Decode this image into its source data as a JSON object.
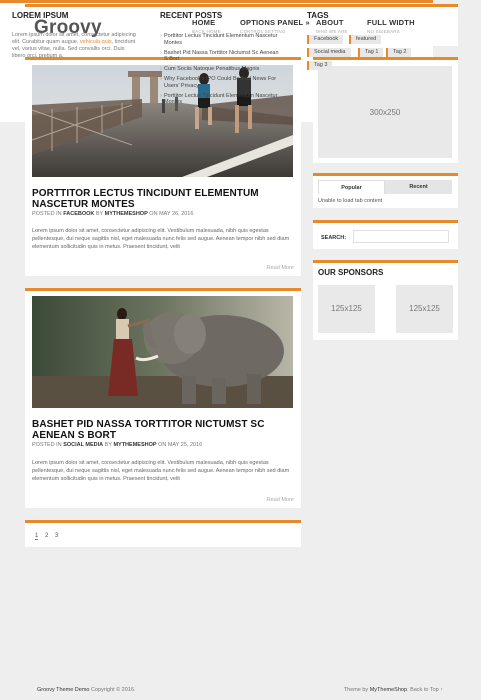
{
  "header": {
    "logo": "Groovy",
    "nav": [
      {
        "label": "HOME",
        "sub": "BACK HOME"
      },
      {
        "label": "OPTIONS PANEL »",
        "sub": "CONTROL SETTING"
      },
      {
        "label": "ABOUT",
        "sub": "WHO WE ARE"
      },
      {
        "label": "FULL WIDTH",
        "sub": "NO SIDEBARS"
      }
    ]
  },
  "posts": [
    {
      "title": "PORTTITOR LECTUS TINCIDUNT ELEMENTUM NASCETUR MONTES",
      "meta_prefix": "POSTED IN",
      "category": "FACEBOOK",
      "by": "BY",
      "author": "MYTHEMESHOP",
      "on": "ON MAY 26, 2016",
      "excerpt": "Lorem ipsum dolor sit amet, consectetur adipiscing elit. Vestibulum malesuada, nibh quis egestas pellentesque, dui neque sagittis nisl, eget malesuada nunc felis sed augue. Aenean tempor nibh sed diam elementum sollicitudin quis in metus. Praesent tincidunt, velit",
      "read_more": "Read More"
    },
    {
      "title": "BASHET PID NASSA TORTTITOR NICTUMST SC AENEAN S BORT",
      "meta_prefix": "POSTED IN",
      "category": "SOCIAL MEDIA",
      "by": "BY",
      "author": "MYTHEMESHOP",
      "on": "ON MAY 25, 2016",
      "excerpt": "Lorem ipsum dolor sit amet, consectetur adipiscing elit. Vestibulum malesuada, nibh quis egestas pellentesque, dui neque sagittis nisl, eget malesuada nunc felis sed augue. Aenean tempor nibh sed diam elementum sollicitudin quis in metus. Praesent tincidunt, velit",
      "read_more": "Read More"
    }
  ],
  "pagination": {
    "pages": [
      "1",
      "2",
      "3"
    ],
    "current": "1"
  },
  "sidebar": {
    "ad_label": "300x250",
    "tabs": {
      "popular": "Popular",
      "recent": "Recent",
      "content": "Unable to load tab content"
    },
    "search_label": "SEARCH:",
    "sponsors_title": "OUR SPONSORS",
    "sponsor_ads": [
      "125x125",
      "125x125"
    ]
  },
  "footer": {
    "lorem_title": "LOREM IPSUM",
    "lorem_text_1": "Lorem ipsum dolor sit amet, consectetur adipiscing elit. Curabitur quam augue, ",
    "lorem_link": "vehicula quis",
    "lorem_text_2": ", tincidunt vel, varius vitae, nulla. Sed convallis orci. Duis libero orci, pretium a.",
    "recent_title": "RECENT POSTS",
    "recent_posts": [
      "Porttitor Lectus Tincidunt Elementum Nascetur Montes",
      "Bashet Pid Nassa Torttitor Nictumst Sc Aenean S Bort",
      "Cum Sociis Natoque Penatibus Magnis",
      "Why Facebook’s IPO Could Be Bad News For Users’ Privacy",
      "Porttitor Lectus Tincidunt Elementum Nascetur Montes"
    ],
    "tags_title": "TAGS",
    "tags": [
      "Facebook",
      "featured",
      "Social media",
      "Tag 1",
      "Tag 2",
      "Tag 3"
    ]
  },
  "bottom": {
    "copyright_site": "Groovy Theme Demo",
    "copyright_text": "Copyright © 2016.",
    "credit_prefix": "Theme by",
    "credit_name": "MyThemeShop",
    "back_to_top": ". Back to Top ↑"
  },
  "colors": {
    "accent": "#e88a2c",
    "background": "#eeeeee"
  }
}
